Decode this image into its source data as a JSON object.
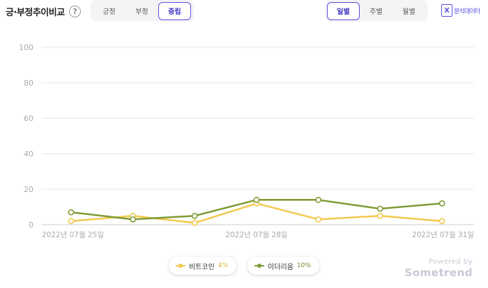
{
  "header": {
    "title": "긍·부정추이비교",
    "help_glyph": "?"
  },
  "sentiment_tabs": {
    "items": [
      {
        "label": "긍정",
        "active": false
      },
      {
        "label": "부정",
        "active": false
      },
      {
        "label": "중립",
        "active": true
      }
    ]
  },
  "period_tabs": {
    "items": [
      {
        "label": "일별",
        "active": true
      },
      {
        "label": "주별",
        "active": false
      },
      {
        "label": "월별",
        "active": false
      }
    ]
  },
  "export": {
    "label": "분석데이터",
    "icon_glyph": "X"
  },
  "colors": {
    "accent": "#5b4fe0",
    "bitcoin": "#f2c94c",
    "ethereum": "#7f9a35"
  },
  "chart_data": {
    "type": "line",
    "title": "",
    "xlabel": "",
    "ylabel": "",
    "ylim": [
      0,
      100
    ],
    "yticks": [
      0,
      20,
      40,
      60,
      80,
      100
    ],
    "x": [
      "2022-07-25",
      "2022-07-26",
      "2022-07-27",
      "2022-07-28",
      "2022-07-29",
      "2022-07-30",
      "2022-07-31"
    ],
    "xtick_labels": [
      {
        "index": 0,
        "label": "2022년 07월 25일"
      },
      {
        "index": 3,
        "label": "2022년 07월 28일"
      },
      {
        "index": 6,
        "label": "2022년 07월 31일"
      }
    ],
    "grid": true,
    "legend": "bottom",
    "series": [
      {
        "name": "비트코인",
        "share": "4%",
        "color": "#f2c94c",
        "values": [
          2,
          5,
          1,
          12,
          3,
          5,
          2
        ]
      },
      {
        "name": "이더리움",
        "share": "10%",
        "color": "#7f9a35",
        "values": [
          7,
          3,
          5,
          14,
          14,
          9,
          12
        ]
      }
    ]
  },
  "powered": {
    "top": "Powered by",
    "brand": "Sometrend"
  }
}
